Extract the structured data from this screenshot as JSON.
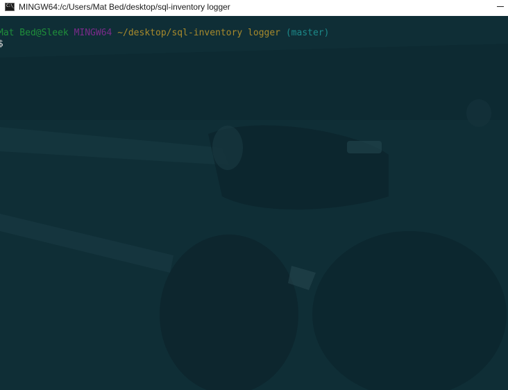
{
  "window": {
    "title": "MINGW64:/c/Users/Mat Bed/desktop/sql-inventory logger",
    "icon": "terminal-icon",
    "icon_glyph": "C:\\_"
  },
  "terminal": {
    "user_host": "Mat Bed@Sleek",
    "system": "MINGW64",
    "path": "~/desktop/sql-inventory logger",
    "branch": "(master)",
    "prompt_symbol": "$"
  },
  "colors": {
    "background": "#0f2f37",
    "user_host": "#1f8f3a",
    "system": "#7a2b8a",
    "path": "#a88a2c",
    "branch": "#1c8a8a"
  }
}
